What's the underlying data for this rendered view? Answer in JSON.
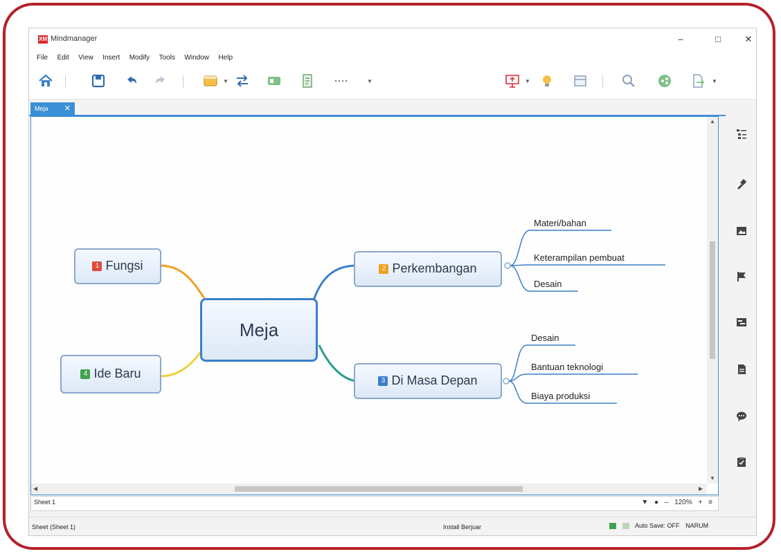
{
  "window": {
    "title": "Mindmanager",
    "logo": "XM",
    "min": "–",
    "max": "□",
    "close": "✕"
  },
  "menu": [
    "File",
    "Edit",
    "View",
    "Insert",
    "Modify",
    "Tools",
    "Window",
    "Help"
  ],
  "tab": {
    "label": "Meja",
    "close": "✕"
  },
  "mindmap": {
    "central": "Meja",
    "left": [
      {
        "num": "1",
        "label": "Fungsi",
        "color": "#e04a3c"
      },
      {
        "num": "4",
        "label": "Ide Baru",
        "color": "#3da34a"
      }
    ],
    "right": [
      {
        "num": "2",
        "label": "Perkembangan",
        "color": "#f0a020",
        "children": [
          "Materi/bahan",
          "Keterampilan pembuat",
          "Desain"
        ]
      },
      {
        "num": "3",
        "label": "Di Masa Depan",
        "color": "#3a7fc8",
        "children": [
          "Desain",
          "Bantuan teknologi",
          "Biaya produksi"
        ]
      }
    ]
  },
  "sheetbar": {
    "tab": "Sheet 1",
    "zoom": "120%",
    "minus": "–",
    "plus": "+",
    "menu": "≡"
  },
  "status": {
    "left": "Sheet (Sheet 1)",
    "middle": "Install Berjuar",
    "autosave": "Auto Save: OFF",
    "caps": "NARUM"
  },
  "colors": {
    "accent": "#3b8fd6",
    "frame": "#b5202a"
  }
}
